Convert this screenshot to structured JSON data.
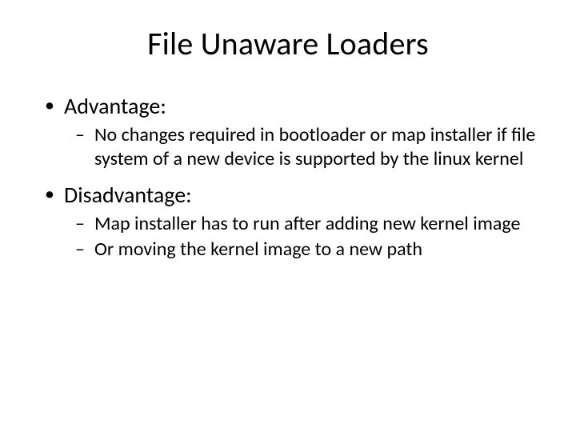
{
  "title": "File Unaware Loaders",
  "bullets": [
    {
      "label": "Advantage:",
      "sub": [
        "No changes required in bootloader or map installer if file system of a new device is supported by the linux kernel"
      ]
    },
    {
      "label": "Disadvantage:",
      "sub": [
        "Map installer has to run after adding new kernel image",
        "Or moving the kernel image to a new path"
      ]
    }
  ]
}
